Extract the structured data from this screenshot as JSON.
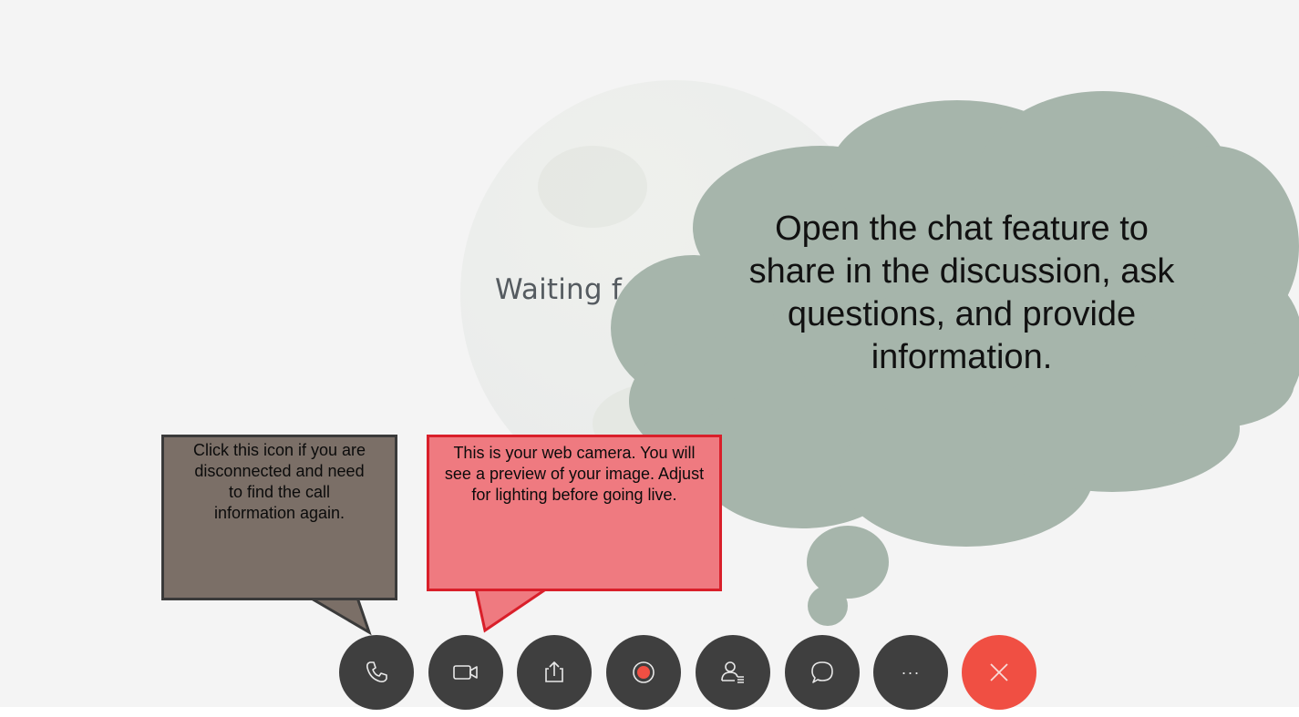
{
  "meeting": {
    "waiting_text": "Waiting f"
  },
  "cloud_callout": {
    "text": "Open the chat feature to share in the discussion, ask questions, and provide information.",
    "color": "#a6b5ab"
  },
  "callouts": {
    "disconnect": {
      "text": "Click this icon if you are disconnected and need to find the call information again.",
      "color": "#7b6f67"
    },
    "camera": {
      "text": "This is your web camera. You will see a preview of your image. Adjust for lighting before going live.",
      "color": "#ef7a80",
      "border_color": "#d91f2a"
    }
  },
  "toolbar": {
    "buttons": [
      {
        "name": "call-button",
        "icon": "phone-icon"
      },
      {
        "name": "video-button",
        "icon": "video-camera-icon"
      },
      {
        "name": "share-button",
        "icon": "share-upload-icon"
      },
      {
        "name": "record-button",
        "icon": "record-icon"
      },
      {
        "name": "participants-button",
        "icon": "participants-icon"
      },
      {
        "name": "chat-button",
        "icon": "chat-bubble-icon"
      },
      {
        "name": "more-options-button",
        "icon": "ellipsis-icon",
        "label": "···"
      },
      {
        "name": "leave-meeting-button",
        "icon": "close-icon"
      }
    ],
    "button_color": "#3f3f3f",
    "leave_color": "#f04f43"
  }
}
